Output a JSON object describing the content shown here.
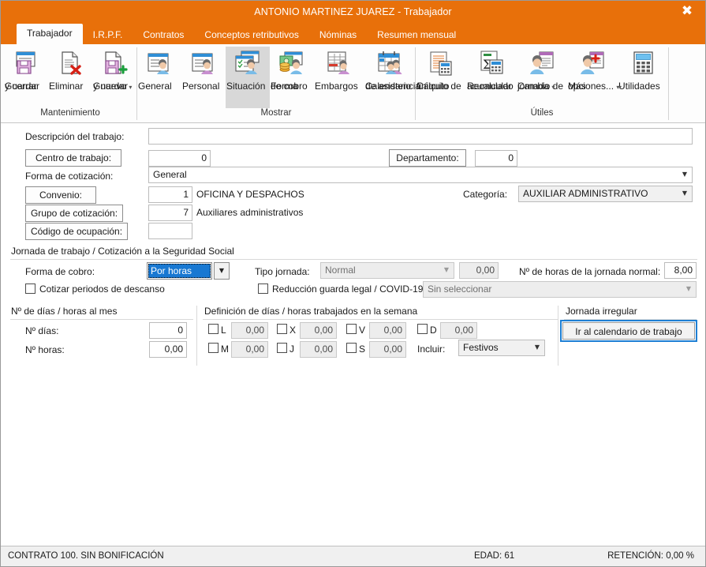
{
  "window": {
    "title": "ANTONIO MARTINEZ JUAREZ - Trabajador",
    "close_icon": "close-icon",
    "close_glyph": "✖",
    "accent_color": "#e8700a",
    "focus_color": "#1e7fd4",
    "selection_color": "#1878d2"
  },
  "tabs": [
    {
      "label": "Trabajador",
      "active": true
    },
    {
      "label": "I.R.P.F.",
      "active": false
    },
    {
      "label": "Contratos",
      "active": false
    },
    {
      "label": "Conceptos retributivos",
      "active": false
    },
    {
      "label": "Nóminas",
      "active": false
    },
    {
      "label": "Resumen mensual",
      "active": false
    }
  ],
  "ribbon": {
    "groups": [
      {
        "label": "Mantenimiento",
        "items": [
          {
            "icon": "save-and-close-icon",
            "line1": "Guardar",
            "line2": "y cerrar",
            "caret": false,
            "selected": false
          },
          {
            "icon": "delete-icon",
            "line1": "Eliminar",
            "line2": "",
            "caret": false,
            "selected": false
          },
          {
            "icon": "save-and-new-icon",
            "line1": "Guardar",
            "line2": "y nuevo",
            "caret": true,
            "selected": false
          }
        ]
      },
      {
        "label": "Mostrar",
        "items": [
          {
            "icon": "general-icon",
            "line1": "General",
            "line2": "",
            "caret": false,
            "selected": false
          },
          {
            "icon": "personal-icon",
            "line1": "Personal",
            "line2": "",
            "caret": false,
            "selected": false
          },
          {
            "icon": "situacion-icon",
            "line1": "Situación",
            "line2": "",
            "caret": false,
            "selected": true
          },
          {
            "icon": "forma-de-cobro-icon",
            "line1": "Forma",
            "line2": "de cobro",
            "caret": false,
            "selected": false
          },
          {
            "icon": "embargos-icon",
            "line1": "Embargos",
            "line2": "",
            "caret": false,
            "selected": false
          },
          {
            "icon": "calendario-asistencia-icon",
            "line1": "Calendario",
            "line2": "de asistencia",
            "caret": false,
            "selected": false
          }
        ]
      },
      {
        "label": "Útiles",
        "items": [
          {
            "icon": "calculo-finiquito-icon",
            "line1": "Cálculo de",
            "line2": "finiquito",
            "caret": false,
            "selected": false
          },
          {
            "icon": "recalcular-acumulado-icon",
            "line1": "Recalcular",
            "line2": "acumulado",
            "caret": false,
            "selected": false
          },
          {
            "icon": "cambio-de-jornada-icon",
            "line1": "Cambio de",
            "line2": "jornada",
            "caret": true,
            "selected": false
          },
          {
            "icon": "mas-opciones-icon",
            "line1": "Más",
            "line2": "opciones...",
            "caret": true,
            "selected": false
          },
          {
            "icon": "utilidades-icon",
            "line1": "Utilidades",
            "line2": "",
            "caret": true,
            "selected": false
          }
        ]
      }
    ]
  },
  "form": {
    "descripcion_label": "Descripción del trabajo:",
    "descripcion_value": "",
    "centro_trabajo_label": "Centro de trabajo:",
    "centro_trabajo_value": "0",
    "departamento_label": "Departamento:",
    "departamento_value": "0",
    "forma_cotizacion_label": "Forma de cotización:",
    "forma_cotizacion_value": "General",
    "convenio_label": "Convenio:",
    "convenio_code": "1",
    "convenio_desc": "OFICINA Y DESPACHOS",
    "categoria_label": "Categoría:",
    "categoria_value": "AUXILIAR ADMINISTRATIVO",
    "grupo_cotizacion_label": "Grupo de cotización:",
    "grupo_cotizacion_code": "7",
    "grupo_cotizacion_desc": "Auxiliares administrativos",
    "codigo_ocupacion_label": "Código de ocupación:",
    "codigo_ocupacion_value": ""
  },
  "jornada": {
    "section_title": "Jornada de trabajo / Cotización a la Seguridad Social",
    "forma_cobro_label": "Forma de cobro:",
    "forma_cobro_value": "Por horas",
    "cotizar_descanso_label": "Cotizar periodos de descanso",
    "cotizar_descanso_checked": false,
    "tipo_jornada_label": "Tipo jornada:",
    "tipo_jornada_value": "Normal",
    "tipo_jornada_pct": "0,00",
    "reduccion_label": "Reducción guarda legal / COVID-19",
    "reduccion_checked": false,
    "reduccion_value": "Sin seleccionar",
    "horas_jornada_label": "Nº de horas de la jornada normal:",
    "horas_jornada_value": "8,00"
  },
  "dias_mes": {
    "section_title": "Nº de días / horas al mes",
    "n_dias_label": "Nº días:",
    "n_dias_value": "0",
    "n_horas_label": "Nº horas:",
    "n_horas_value": "0,00"
  },
  "semana": {
    "section_title": "Definición de días / horas trabajados en la semana",
    "days": [
      {
        "code": "L",
        "value": "0,00",
        "checked": false
      },
      {
        "code": "M",
        "value": "0,00",
        "checked": false
      },
      {
        "code": "X",
        "value": "0,00",
        "checked": false
      },
      {
        "code": "J",
        "value": "0,00",
        "checked": false
      },
      {
        "code": "V",
        "value": "0,00",
        "checked": false
      },
      {
        "code": "S",
        "value": "0,00",
        "checked": false
      },
      {
        "code": "D",
        "value": "0,00",
        "checked": false
      }
    ],
    "incluir_label": "Incluir:",
    "incluir_value": "Festivos"
  },
  "jornada_irregular": {
    "section_title": "Jornada irregular",
    "button_label": "Ir al calendario de trabajo"
  },
  "statusbar": {
    "left": "CONTRATO 100.  SIN BONIFICACIÓN",
    "middle": "EDAD: 61",
    "right": "RETENCIÓN: 0,00 %"
  }
}
